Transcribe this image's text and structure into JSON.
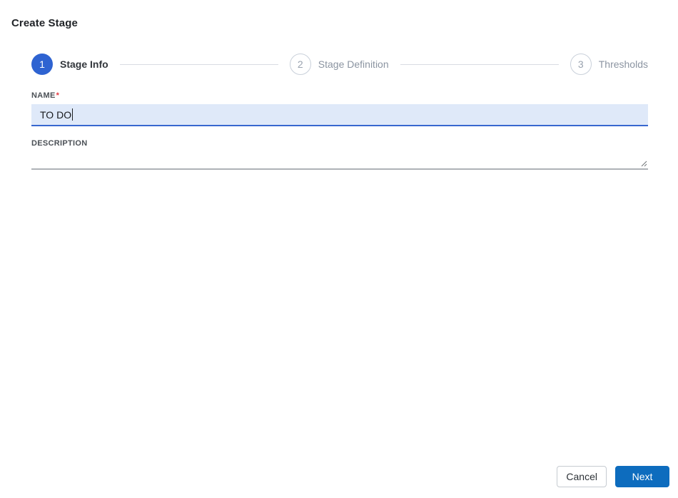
{
  "dialog": {
    "title": "Create Stage"
  },
  "stepper": {
    "steps": [
      {
        "number": "1",
        "label": "Stage Info",
        "state": "active"
      },
      {
        "number": "2",
        "label": "Stage Definition",
        "state": "inactive"
      },
      {
        "number": "3",
        "label": "Thresholds",
        "state": "inactive"
      }
    ]
  },
  "form": {
    "name": {
      "label": "NAME",
      "required_marker": "*",
      "value": "TO DO",
      "placeholder": ""
    },
    "description": {
      "label": "DESCRIPTION",
      "value": "",
      "placeholder": ""
    }
  },
  "footer": {
    "cancel_label": "Cancel",
    "next_label": "Next"
  },
  "icons": {
    "textarea_resize": "resize-handle-icon"
  },
  "colors": {
    "active_step_blue": "#2e63d1",
    "inactive_step_border": "#c9d0da",
    "inactive_text_gray": "#8b94a1",
    "input_focus_background": "#dfe9f9",
    "input_focus_border": "#3767cf",
    "required_red": "#e5383f",
    "next_button_blue": "#0d6cbe",
    "connector_gray": "#d8dce2"
  }
}
